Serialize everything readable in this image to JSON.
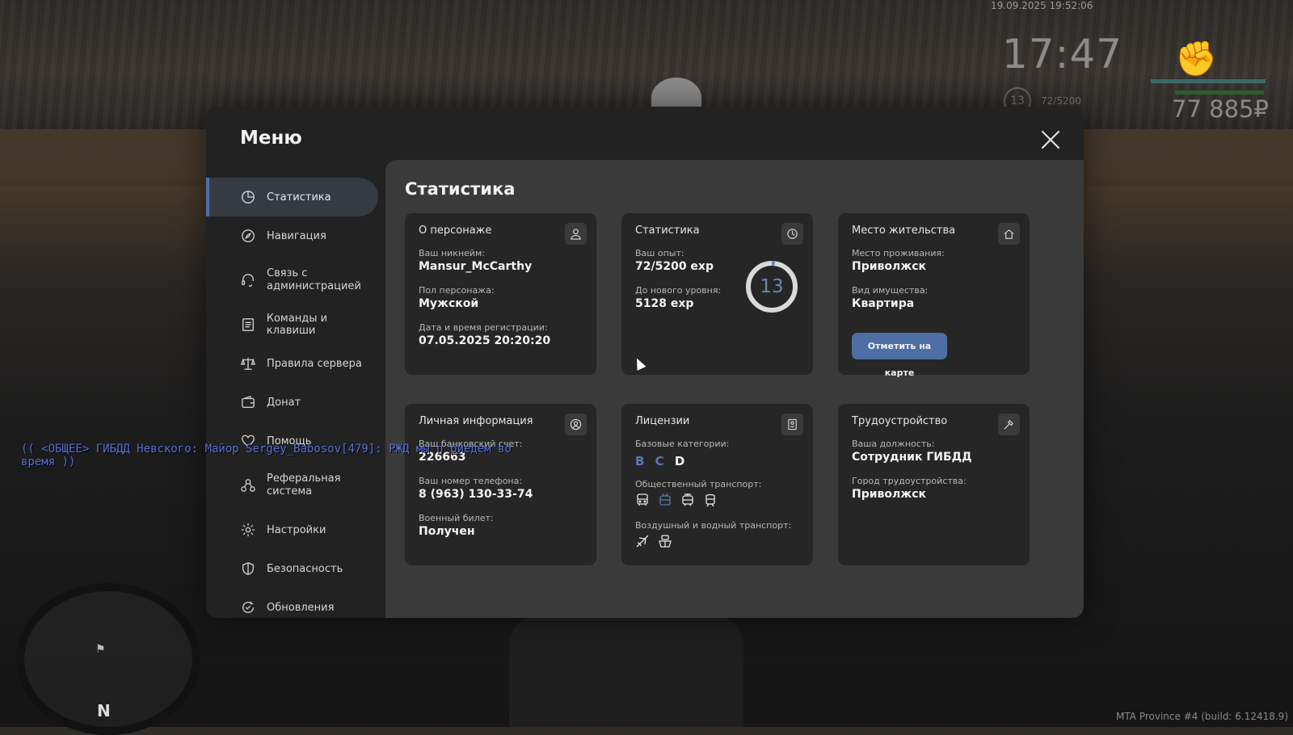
{
  "hud": {
    "datetime": "19.09.2025 19:52:06",
    "clock": "17:47",
    "level": "13",
    "exp": "72/5200",
    "money": "77 885₽"
  },
  "chat": {
    "line": "(( <ОБЩЕЕ> ГИБДД Невского: Майор Sergey_Babosov[479]: РЖД мы п риедем во время ))"
  },
  "radar": {
    "north": "N"
  },
  "build": "MTA Province #4 (build: 6.12418.9)",
  "menu": {
    "title": "Меню",
    "sidebar": [
      {
        "label": "Статистика",
        "icon": "stats-icon"
      },
      {
        "label": "Навигация",
        "icon": "compass-icon"
      },
      {
        "label": "Связь с администрацией",
        "icon": "headset-icon"
      },
      {
        "label": "Команды и клавиши",
        "icon": "list-icon"
      },
      {
        "label": "Правила сервера",
        "icon": "scales-icon"
      },
      {
        "label": "Донат",
        "icon": "wallet-icon"
      },
      {
        "label": "Помощь",
        "icon": "help-icon"
      },
      {
        "label": "Реферальная система",
        "icon": "referral-icon"
      },
      {
        "label": "Настройки",
        "icon": "gear-icon"
      },
      {
        "label": "Безопасность",
        "icon": "shield-icon"
      },
      {
        "label": "Обновления",
        "icon": "update-icon"
      }
    ],
    "active_index": 0
  },
  "content": {
    "title": "Статистика",
    "character": {
      "title": "О персонаже",
      "nickname_label": "Ваш никнейм:",
      "nickname": "Mansur_McCarthy",
      "gender_label": "Пол персонажа:",
      "gender": "Мужской",
      "reg_label": "Дата и время регистрации:",
      "reg": "07.05.2025 20:20:20"
    },
    "stats": {
      "title": "Статистика",
      "exp_label": "Ваш опыт:",
      "exp": "72/5200 exp",
      "next_label": "До нового уровня:",
      "next": "5128 exp",
      "level": "13",
      "progress": 0.0138
    },
    "residence": {
      "title": "Место жительства",
      "place_label": "Место проживания:",
      "place": "Приволжск",
      "property_label": "Вид имущества:",
      "property": "Квартира",
      "map_button": "Отметить на карте"
    },
    "personal": {
      "title": "Личная информация",
      "bank_label": "Ваш банковский счет:",
      "bank": "226663",
      "phone_label": "Ваш номер телефона:",
      "phone": "8 (963) 130-33-74",
      "military_label": "Военный билет:",
      "military": "Получен"
    },
    "licenses": {
      "title": "Лицензии",
      "base_label": "Базовые категории:",
      "categories": [
        "B",
        "C",
        "D"
      ],
      "public_label": "Общественный транспорт:",
      "air_label": "Воздушный и водный транспорт:"
    },
    "employment": {
      "title": "Трудоустройство",
      "position_label": "Ваша должность:",
      "position": "Сотрудник ГИБДД",
      "city_label": "Город трудоустройства:",
      "city": "Приволжск"
    }
  },
  "colors": {
    "accent": "#4e6fa6",
    "ring": "#6a86b8",
    "category_inactive": "#5a79b0"
  }
}
